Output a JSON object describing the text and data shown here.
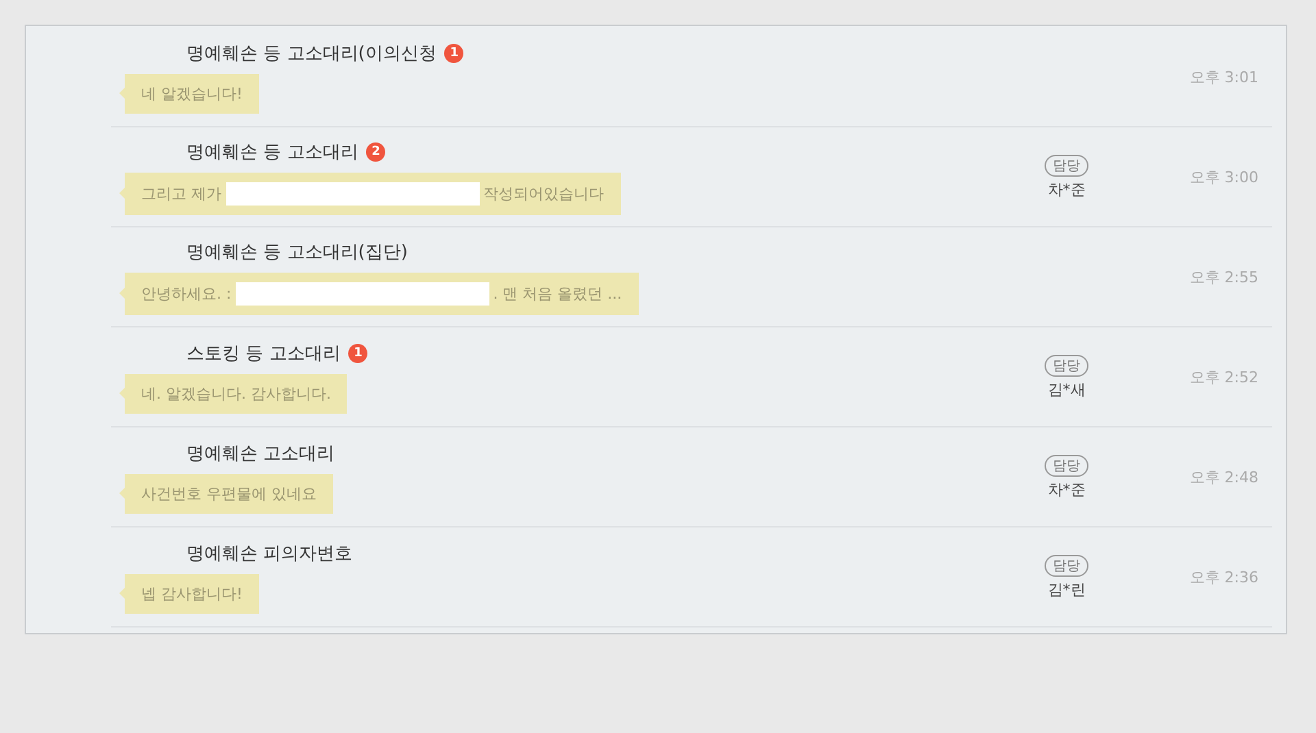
{
  "chats": [
    {
      "title": "명예훼손 등 고소대리(이의신청",
      "unread": "1",
      "message": [
        {
          "kind": "text",
          "text": "네 알겠습니다!"
        }
      ],
      "time": "오후 3:01"
    },
    {
      "title": "명예훼손 등 고소대리",
      "unread": "2",
      "message": [
        {
          "kind": "text",
          "text": "그리고 제가"
        },
        {
          "kind": "redacted"
        },
        {
          "kind": "text",
          "text": "작성되어있습니다"
        }
      ],
      "assignee_tag": "담당",
      "assignee": "차*준",
      "time": "오후 3:00"
    },
    {
      "title": "명예훼손 등 고소대리(집단)",
      "message": [
        {
          "kind": "text",
          "text": "안녕하세요. :"
        },
        {
          "kind": "redacted"
        },
        {
          "kind": "text",
          "text": ". 맨 처음 올렸던 ..."
        }
      ],
      "time": "오후 2:55"
    },
    {
      "title": "스토킹 등 고소대리",
      "unread": "1",
      "message": [
        {
          "kind": "text",
          "text": "네. 알겠습니다. 감사합니다."
        }
      ],
      "assignee_tag": "담당",
      "assignee": "김*새",
      "time": "오후 2:52"
    },
    {
      "title": "명예훼손 고소대리",
      "message": [
        {
          "kind": "text",
          "text": "사건번호 우편물에 있네요"
        }
      ],
      "assignee_tag": "담당",
      "assignee": "차*준",
      "time": "오후 2:48"
    },
    {
      "title": "명예훼손 피의자변호",
      "message": [
        {
          "kind": "text",
          "text": "넵 감사합니다!"
        }
      ],
      "assignee_tag": "담당",
      "assignee": "김*린",
      "time": "오후 2:36"
    }
  ]
}
